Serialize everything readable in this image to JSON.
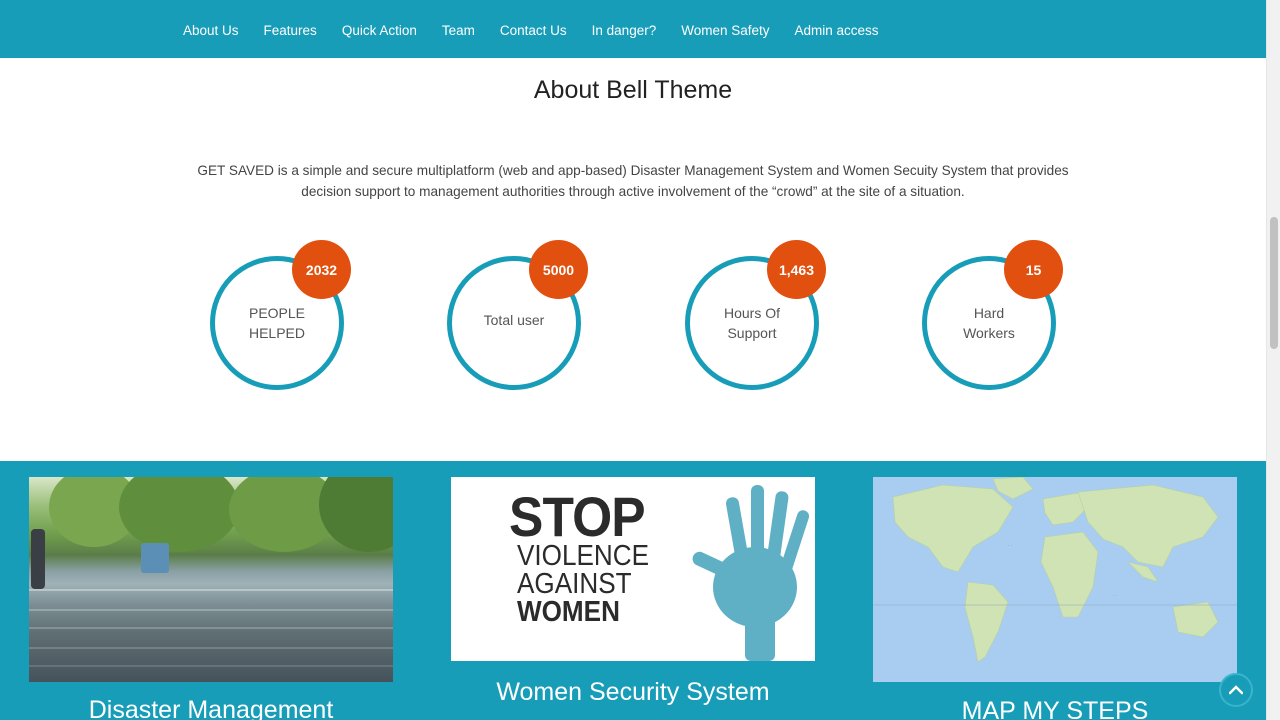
{
  "nav": {
    "items": [
      "About Us",
      "Features",
      "Quick Action",
      "Team",
      "Contact Us",
      "In danger?",
      "Women Safety",
      "Admin access"
    ]
  },
  "about": {
    "title": "About Bell Theme",
    "description": "GET SAVED is a simple and secure multiplatform (web and app-based) Disaster Management System and Women Secuity System that provides decision support to management authorities through active involvement of the “crowd” at the site of a situation."
  },
  "stats": [
    {
      "value": "2032",
      "label_line1": "PEOPLE",
      "label_line2": "HELPED"
    },
    {
      "value": "5000",
      "label_line1": "Total user",
      "label_line2": ""
    },
    {
      "value": "1,463",
      "label_line1": "Hours Of",
      "label_line2": "Support"
    },
    {
      "value": "15",
      "label_line1": "Hard",
      "label_line2": "Workers"
    }
  ],
  "features": {
    "disaster_title": "Disaster Management",
    "women_title": "Women Security System",
    "map_title": "MAP MY STEPS",
    "poster": {
      "line1": "STOP",
      "line2": "VIOLENCE",
      "line3": "AGAINST",
      "line4": "WOMEN"
    }
  },
  "colors": {
    "primary": "#189db8",
    "accent": "#e2500f"
  },
  "icons": {
    "back_to_top": "chevron-up-icon"
  }
}
